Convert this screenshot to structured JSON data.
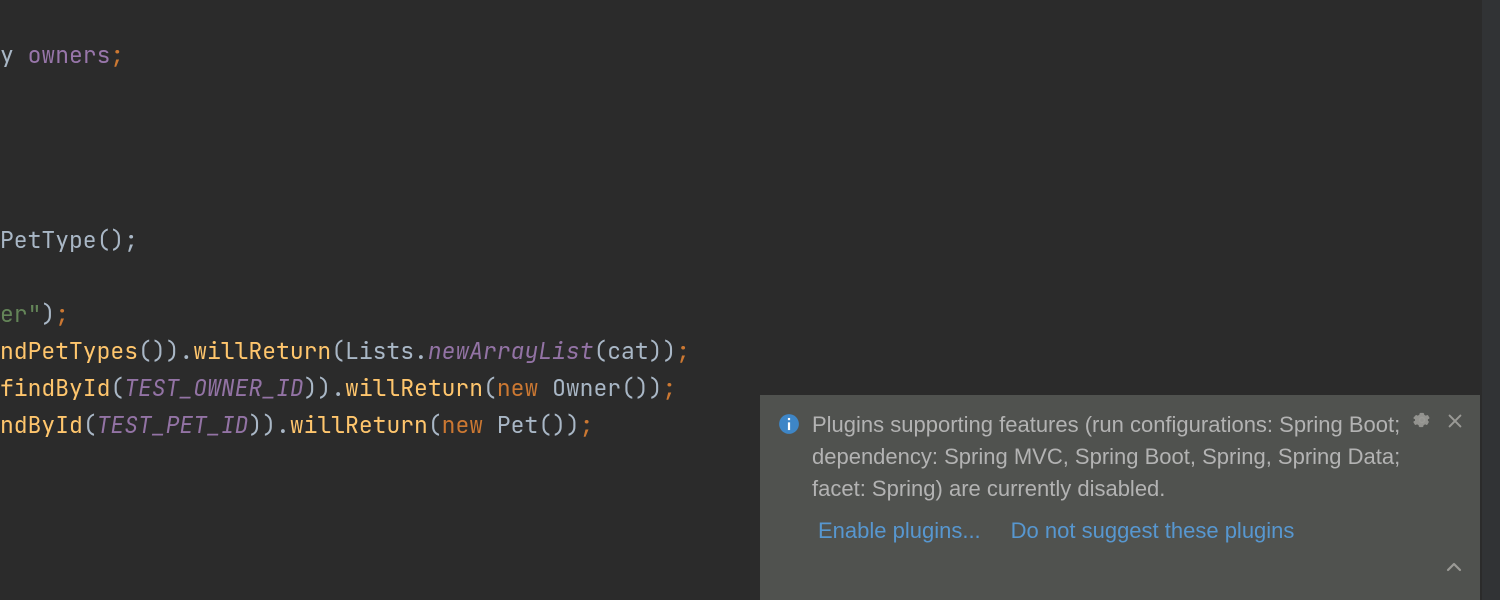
{
  "colors": {
    "editor_bg": "#2b2b2b",
    "editor_fg": "#a9b7c6",
    "keyword": "#cc7832",
    "method": "#ffc66d",
    "static_member": "#9373a5",
    "field": "#9876aa",
    "string": "#648558",
    "notif_bg": "#50524f",
    "notif_fg": "#bababa",
    "link": "#5797d0",
    "gutter_bar": "#313335"
  },
  "code": {
    "line1_a": "y ",
    "line1_b": "owners",
    "line1_c": ";",
    "line2_a": "PetType",
    "line2_b": "();",
    "line3_a": "er\"",
    "line3_b": ")",
    "line3_c": ";",
    "line4_a": "ndPetTypes",
    "line4_b": "()).",
    "line4_c": "willReturn",
    "line4_d": "(Lists.",
    "line4_e": "newArrayList",
    "line4_f": "(cat))",
    "line4_g": ";",
    "line5_a": "findById",
    "line5_b": "(",
    "line5_c": "TEST_OWNER_ID",
    "line5_d": ")).",
    "line5_e": "willReturn",
    "line5_f": "(",
    "line5_g": "new ",
    "line5_h": "Owner())",
    "line5_i": ";",
    "line6_a": "ndById",
    "line6_b": "(",
    "line6_c": "TEST_PET_ID",
    "line6_d": ")).",
    "line6_e": "willReturn",
    "line6_f": "(",
    "line6_g": "new ",
    "line6_h": "Pet())",
    "line6_i": ";"
  },
  "notification": {
    "message": "Plugins supporting features (run configurations: Spring Boot; dependency: Spring MVC, Spring Boot, Spring, Spring Data; facet: Spring) are currently disabled.",
    "action_enable": "Enable plugins...",
    "action_dismiss": "Do not suggest these plugins"
  }
}
